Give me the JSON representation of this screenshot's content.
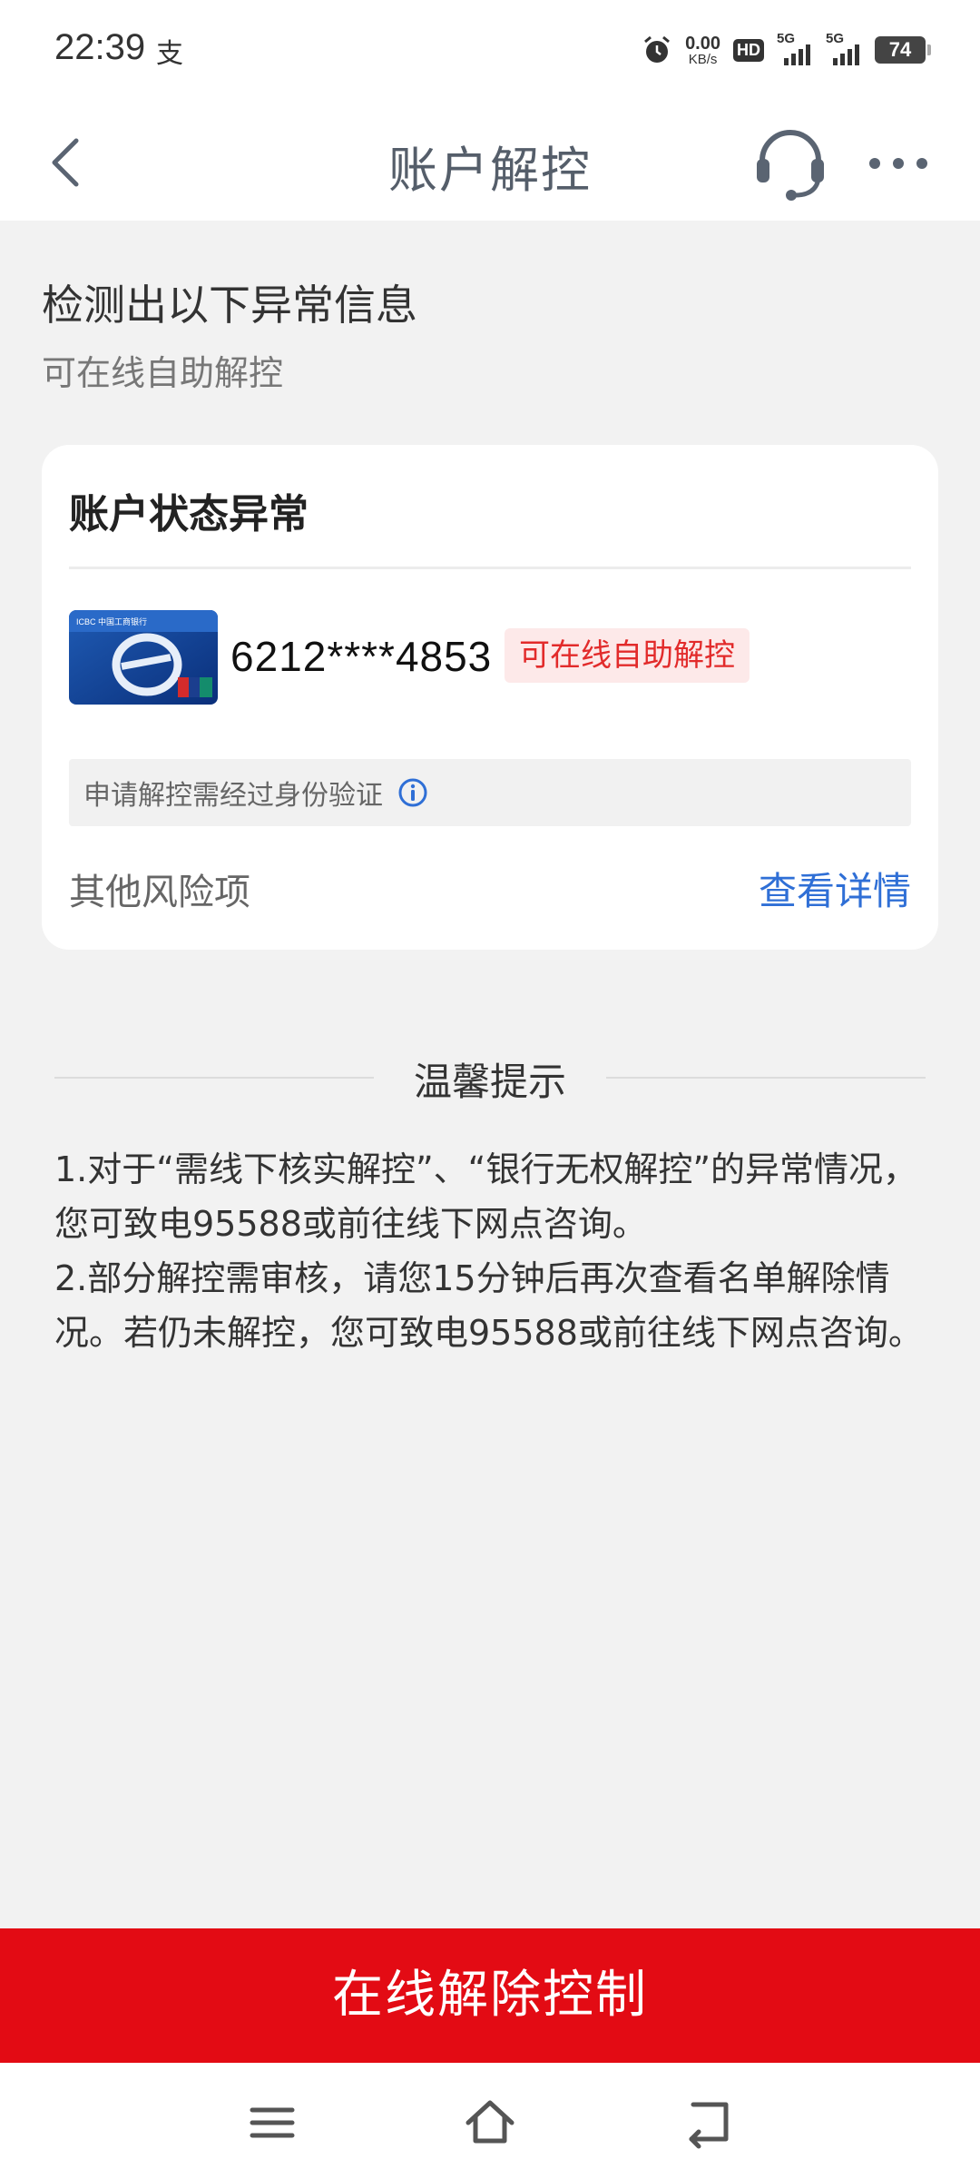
{
  "status_bar": {
    "time": "22:39",
    "pay_indicator": "支",
    "net_speed_value": "0.00",
    "net_speed_unit": "KB/s",
    "hd_badge": "HD",
    "signal1_label": "5G",
    "signal2_label": "5G",
    "battery": "74",
    "icons": [
      "alarm-icon",
      "signal-icon",
      "battery-icon"
    ]
  },
  "nav": {
    "title": "账户解控",
    "icons": [
      "back-icon",
      "customer-service-icon",
      "more-icon"
    ]
  },
  "header": {
    "headline": "检测出以下异常信息",
    "subline": "可在线自助解控"
  },
  "card": {
    "title": "账户状态异常",
    "card_number": "6212****4853",
    "status_badge": "可在线自助解控",
    "verify_notice": "申请解控需经过身份验证",
    "other_risk_label": "其他风险项",
    "view_details_link": "查看详情",
    "bank_card_logo_text": "ICBC 中国工商银行"
  },
  "tips": {
    "title": "温馨提示",
    "items": [
      "1.对于“需线下核实解控”、“银行无权解控”的异常情况，您可致电95588或前往线下网点咨询。",
      "2.部分解控需审核，请您15分钟后再次查看名单解除情况。若仍未解控，您可致电95588或前往线下网点咨询。"
    ]
  },
  "action": {
    "primary_button": "在线解除控制"
  },
  "system_nav": {
    "icons": [
      "menu-icon",
      "home-icon",
      "back-nav-icon"
    ]
  },
  "colors": {
    "accent_red": "#e30b14",
    "badge_red": "#e22b2b",
    "link_blue": "#2f6fd6",
    "background": "#f2f2f2"
  }
}
